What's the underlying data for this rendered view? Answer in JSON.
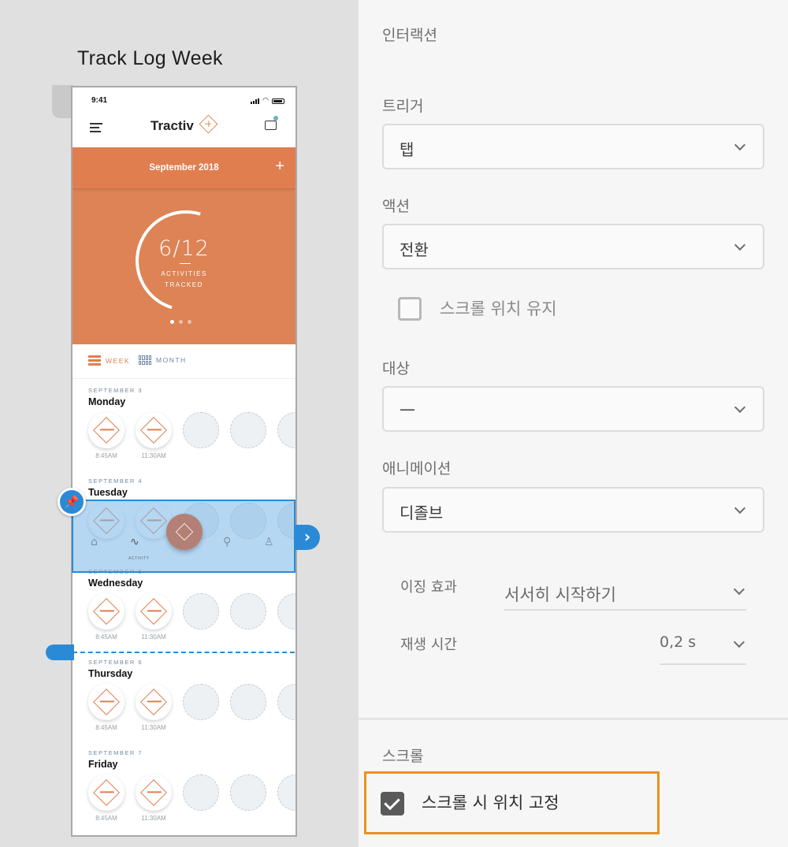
{
  "canvas": {
    "artboard_title": "Track Log Week",
    "phone": {
      "time": "9:41",
      "brand": "Tractiv",
      "month": "September 2018",
      "plus": "+",
      "count": "6/12",
      "count_caption_1": "ACTIVITIES",
      "count_caption_2": "TRACKED",
      "tab_week": "WEEK",
      "tab_month": "MONTH",
      "days": [
        {
          "date": "SEPTEMBER 3",
          "name": "Monday",
          "times": [
            "8:45AM",
            "11:30AM"
          ]
        },
        {
          "date": "SEPTEMBER 4",
          "name": "Tuesday",
          "times": [
            "",
            ""
          ]
        },
        {
          "date": "SEPTEMBER 5",
          "name": "Wednesday",
          "times": [
            "8:45AM",
            "11:30AM"
          ]
        },
        {
          "date": "SEPTEMBER 6",
          "name": "Thursday",
          "times": [
            "8:45AM",
            "11:30AM"
          ]
        },
        {
          "date": "SEPTEMBER 7",
          "name": "Friday",
          "times": [
            "8:45AM",
            "11:30AM"
          ]
        }
      ],
      "tabbar": {
        "activity_label": "ACTIVITY"
      }
    }
  },
  "panel": {
    "section_title": "인터랙션",
    "trigger": {
      "label": "트리거",
      "value": "탭"
    },
    "action": {
      "label": "액션",
      "value": "전환"
    },
    "keep_scroll": {
      "label": "스크롤 위치 유지",
      "checked": false
    },
    "destination": {
      "label": "대상",
      "value": "—"
    },
    "animation": {
      "label": "애니메이션",
      "value": "디졸브"
    },
    "easing": {
      "label": "이징 효과",
      "value": "서서히 시작하기"
    },
    "duration": {
      "label": "재생 시간",
      "value": "0,2 s"
    },
    "scroll_section": {
      "label": "스크롤"
    },
    "fix_position": {
      "label": "스크롤 시 위치 고정",
      "checked": true
    }
  },
  "colors": {
    "accent": "#2b8ad6",
    "brand_orange": "#dd8355",
    "highlight": "#e8931c"
  }
}
